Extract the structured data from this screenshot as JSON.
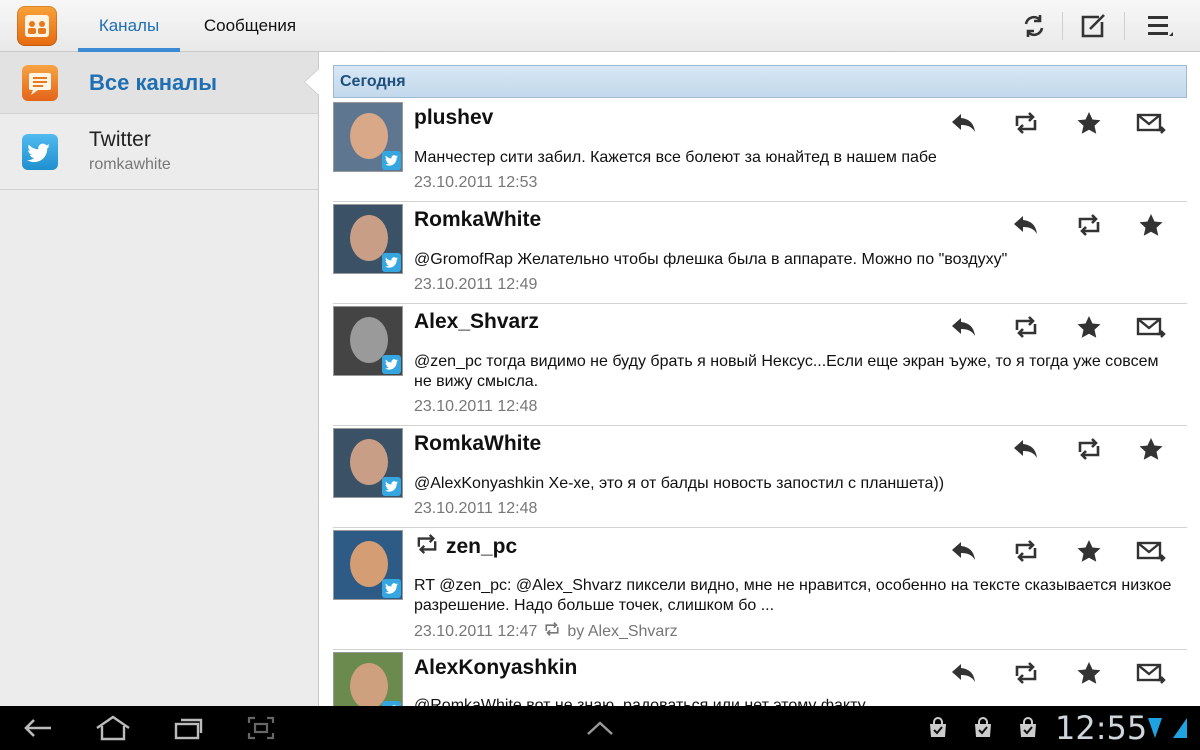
{
  "header": {
    "tabs": [
      {
        "label": "Каналы",
        "active": true
      },
      {
        "label": "Сообщения",
        "active": false
      }
    ],
    "icons": [
      "refresh-icon",
      "compose-icon",
      "menu-icon"
    ]
  },
  "sidebar": {
    "items": [
      {
        "title": "Все каналы",
        "icon": "channels-icon",
        "selected": true
      },
      {
        "title": "Twitter",
        "subtitle": "romkawhite",
        "icon": "twitter-icon",
        "selected": false
      }
    ]
  },
  "feed": {
    "section_label": "Сегодня",
    "tweets": [
      {
        "author": "plushev",
        "text": "Манчестер сити забил. Кажется все болеют за юнайтед в нашем пабе",
        "time": "23.10.2011 12:53",
        "retweet_by": ""
      },
      {
        "author": "RomkaWhite",
        "text": "@GromofRap Желательно чтобы флешка была в аппарате. Можно по \"воздуху\"",
        "time": "23.10.2011 12:49",
        "retweet_by": ""
      },
      {
        "author": "Alex_Shvarz",
        "text": "@zen_pc тогда видимо не буду брать я новый Нексус...Если еще экран ъуже, то я тогда уже совсем не вижу смысла.",
        "time": "23.10.2011 12:48",
        "retweet_by": ""
      },
      {
        "author": "RomkaWhite",
        "text": "@AlexKonyashkin Хе-хе, это я от балды новость запостил с планшета))",
        "time": "23.10.2011 12:48",
        "retweet_by": ""
      },
      {
        "author": "zen_pc",
        "text": "RT @zen_pc: @Alex_Shvarz пиксели видно, мне не нравится, особенно на тексте сказывается низкое разрешение. Надо больше точек, слишком бо ...",
        "time": "23.10.2011 12:47",
        "retweet_by": "by Alex_Shvarz"
      },
      {
        "author": "AlexKonyashkin",
        "text": "@RomkaWhite вот не знаю, радоваться или нет этому факту",
        "time": "",
        "retweet_by": ""
      }
    ]
  },
  "statusbar": {
    "clock": "12:55"
  },
  "colors": {
    "accent": "#1e6fb3",
    "twitter": "#35a6df",
    "app_orange": "#f08a24"
  }
}
